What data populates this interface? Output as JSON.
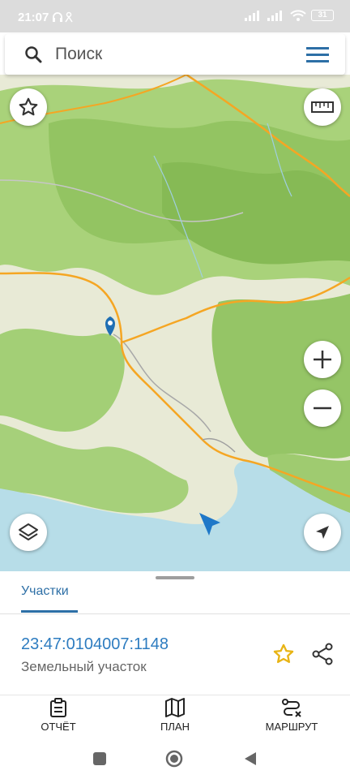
{
  "status_bar": {
    "time": "21:07",
    "battery": "31"
  },
  "search": {
    "placeholder": "Поиск",
    "value": ""
  },
  "map": {
    "buttons": [
      "favorites-button",
      "ruler-button",
      "zoom-in-button",
      "zoom-out-button",
      "layers-button",
      "location-button"
    ],
    "colors": {
      "forest": "#9ccc65",
      "land": "#e9ecd8",
      "sea": "#b7dde8",
      "road": "#f5a623"
    }
  },
  "sheet": {
    "tab_label": "Участки",
    "parcel_number": "23:47:0104007:1148",
    "parcel_type": "Земельный участок"
  },
  "bottom_nav": {
    "report_label": "ОТЧЁТ",
    "plan_label": "ПЛАН",
    "route_label": "МАРШРУТ"
  },
  "colors": {
    "accent": "#2d7cc0",
    "star": "#e8b415"
  }
}
